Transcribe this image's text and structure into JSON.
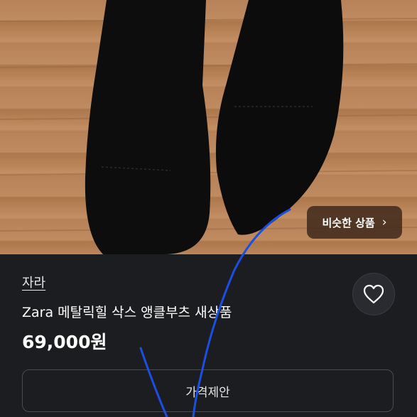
{
  "product": {
    "seller": "자라",
    "title": "Zara 메탈릭힐 삭스 앵클부츠 새상품",
    "price": "69,000원"
  },
  "similar_button": {
    "label": "비슷한 상품",
    "icon": "chevron-right-icon"
  },
  "like_button": {
    "icon": "heart-icon"
  },
  "offer_button": {
    "label": "가격제안"
  },
  "colors": {
    "background": "#1c1d21",
    "scribble": "#1a4fe0"
  }
}
